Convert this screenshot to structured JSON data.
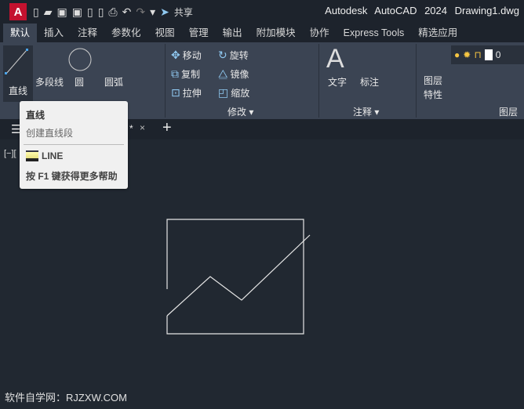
{
  "app": {
    "logo": "A",
    "title": "Autodesk AutoCAD 2024",
    "file": "Drawing1.dwg",
    "share": "共享"
  },
  "ribbon_tabs": [
    "默认",
    "插入",
    "注释",
    "参数化",
    "视图",
    "管理",
    "输出",
    "附加模块",
    "协作",
    "Express Tools",
    "精选应用"
  ],
  "draw": {
    "line": "直线",
    "polyline": "多段线",
    "circle": "圆",
    "arc": "圆弧"
  },
  "modify": {
    "move": "移动",
    "rotate": "旋转",
    "copy": "复制",
    "mirror": "镜像",
    "stretch": "拉伸",
    "scale": "缩放",
    "panel": "修改 ▾"
  },
  "annotation": {
    "text": "文字",
    "dim": "标注",
    "panel": "注释 ▾"
  },
  "layers": {
    "props_line1": "图层",
    "props_line2": "特性",
    "current": "0",
    "panel": "图层"
  },
  "doctab": {
    "close": "×",
    "add": "+",
    "star": "*"
  },
  "tooltip": {
    "title": "直线",
    "desc": "创建直线段",
    "command": "LINE",
    "help": "按 F1 键获得更多帮助"
  },
  "viewport_label": "[−][",
  "watermark": "软件自学网：RJZXW.COM",
  "colors": {
    "accent": "#c4122f",
    "canvas": "#212831",
    "ribbon": "#3b4453"
  }
}
